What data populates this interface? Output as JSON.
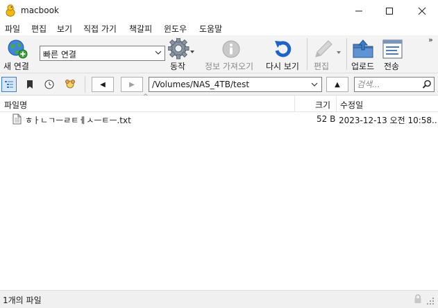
{
  "window": {
    "title": "macbook",
    "controls": [
      "minimize",
      "maximize",
      "close"
    ]
  },
  "menu": {
    "items": [
      "파일",
      "편집",
      "보기",
      "직접 가기",
      "책갈피",
      "윈도우",
      "도움말"
    ]
  },
  "toolbar": {
    "new_connection": "새 연결",
    "quick_connect": "빠른 연결",
    "action": "동작",
    "get_info": "정보 가져오기",
    "refresh": "다시 보기",
    "edit": "편집",
    "upload": "업로드",
    "transfer": "전송",
    "overflow": "»"
  },
  "navbar": {
    "path": "/Volumes/NAS_4TB/test",
    "back": "◀",
    "forward": "▶",
    "up": "▲",
    "search_placeholder": "검색..."
  },
  "columns": {
    "filename": "파일명",
    "size": "크기",
    "modified": "수정일",
    "sort_indicator": "^"
  },
  "files": [
    {
      "name": "ㅎㅏㄴㄱㅡㄹㅌㅔㅅㅡㅌㅡ.txt",
      "size": "52 B",
      "modified": "2023-12-13 오전 10:58..."
    }
  ],
  "status": {
    "text": "1개의 파일"
  },
  "colors": {
    "accent": "#2f6fd6",
    "toolbar_bg": "#f3f3f3",
    "status_bg": "#f0f0f0",
    "disabled_text": "#8a8a8a"
  }
}
